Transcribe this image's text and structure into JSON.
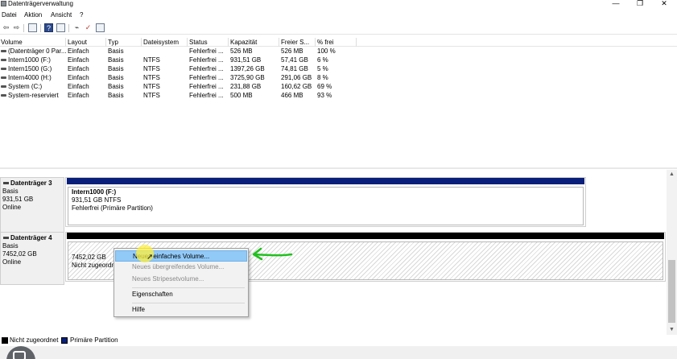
{
  "window": {
    "title": "Datenträgerverwaltung",
    "minimize_glyph": "—",
    "maximize_glyph": "❐",
    "close_glyph": "✕"
  },
  "menu": [
    "Datei",
    "Aktion",
    "Ansicht",
    "?"
  ],
  "toolbar_icons": [
    "back-arrow-icon",
    "forward-arrow-icon",
    "properties-icon",
    "help-icon",
    "console-tree-icon",
    "connect-icon",
    "check-icon",
    "format-icon"
  ],
  "table": {
    "columns": [
      "Volume",
      "Layout",
      "Typ",
      "Dateisystem",
      "Status",
      "Kapazität",
      "Freier S...",
      "% frei"
    ],
    "rows": [
      [
        "(Datenträger 0 Par...",
        "Einfach",
        "Basis",
        "",
        "Fehlerfrei ...",
        "526 MB",
        "526 MB",
        "100 %"
      ],
      [
        "Intern1000 (F:)",
        "Einfach",
        "Basis",
        "NTFS",
        "Fehlerfrei ...",
        "931,51 GB",
        "57,41 GB",
        "6 %"
      ],
      [
        "Intern1500 (G:)",
        "Einfach",
        "Basis",
        "NTFS",
        "Fehlerfrei ...",
        "1397,26 GB",
        "74,81 GB",
        "5 %"
      ],
      [
        "Intern4000 (H:)",
        "Einfach",
        "Basis",
        "NTFS",
        "Fehlerfrei ...",
        "3725,90 GB",
        "291,06 GB",
        "8 %"
      ],
      [
        "System (C:)",
        "Einfach",
        "Basis",
        "NTFS",
        "Fehlerfrei ...",
        "231,88 GB",
        "160,62 GB",
        "69 %"
      ],
      [
        "System-reserviert",
        "Einfach",
        "Basis",
        "NTFS",
        "Fehlerfrei ...",
        "500 MB",
        "466 MB",
        "93 %"
      ]
    ]
  },
  "disks": [
    {
      "name": "Datenträger 3",
      "type": "Basis",
      "size": "931,51 GB",
      "status": "Online",
      "partition": {
        "name": "Intern1000  (F:)",
        "size_fs": "931,51 GB NTFS",
        "status": "Fehlerfrei (Primäre Partition)"
      }
    },
    {
      "name": "Datenträger 4",
      "type": "Basis",
      "size": "7452,02 GB",
      "status": "Online",
      "partition": {
        "size": "7452,02 GB",
        "status": "Nicht zugeordn"
      }
    }
  ],
  "context_menu": {
    "items": [
      {
        "label": "Neues einfaches Volume...",
        "enabled": true,
        "highlighted": true
      },
      {
        "label": "Neues übergreifendes Volume...",
        "enabled": false
      },
      {
        "label": "Neues Stripesetvolume...",
        "enabled": false
      },
      {
        "label": "Eigenschaften",
        "enabled": true
      },
      {
        "label": "Hilfe",
        "enabled": true
      }
    ]
  },
  "legend": [
    {
      "label": "Nicht zugeordnet",
      "color": "#000000"
    },
    {
      "label": "Primäre Partition",
      "color": "#0a1f7a"
    }
  ],
  "colors": {
    "primary_partition_bar": "#0a1f7a",
    "unallocated_bar": "#000000",
    "menu_highlight": "#91c9f7",
    "annotation_arrow": "#22c01e",
    "cursor_highlight": "#fff03c"
  }
}
